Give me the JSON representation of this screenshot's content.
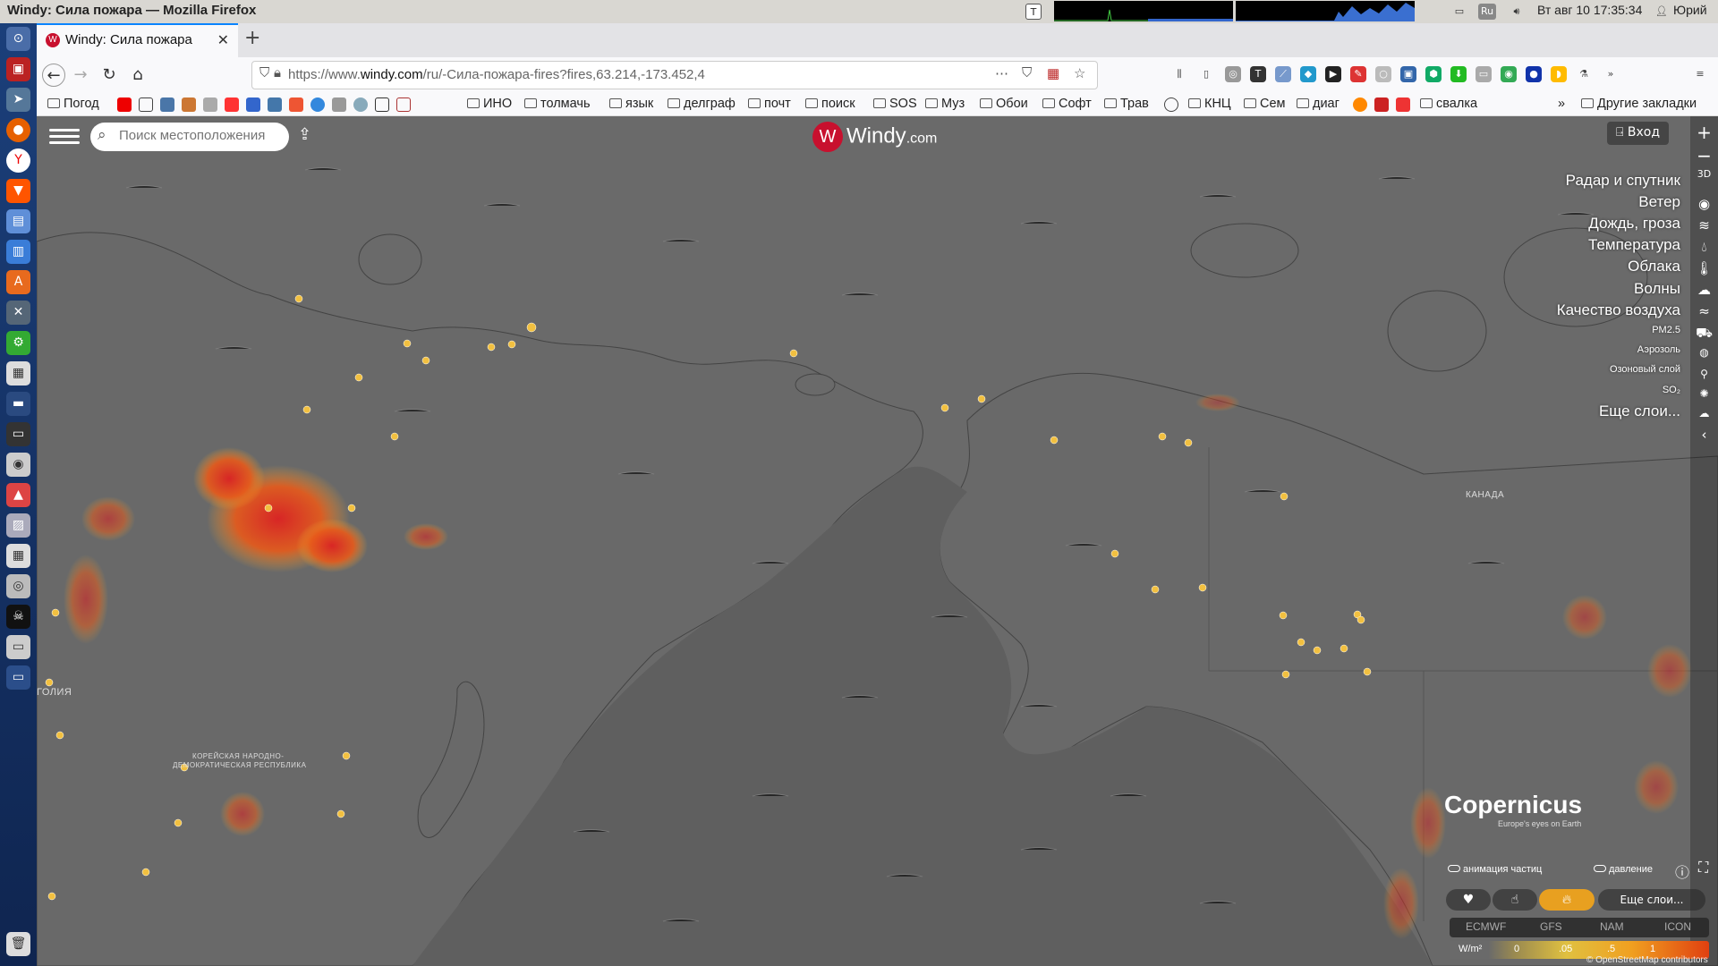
{
  "window": {
    "title": "Windy: Сила пожара — Mozilla Firefox"
  },
  "system": {
    "clock": "Вт авг 10 17:35:34",
    "user": "Юрий",
    "keyboard": "Ru"
  },
  "tabs": [
    {
      "title": "Windy: Сила пожара"
    }
  ],
  "url": {
    "prefix": "https://www.",
    "domain": "windy.com",
    "path": "/ru/-Сила-пожара-fires?fires,63.214,-173.452,4"
  },
  "bookmarks": [
    "Погод",
    "ИНО",
    "толмачь",
    "язык",
    "делграф",
    "почт",
    "поиск",
    "SOS",
    "Муз",
    "Обои",
    "Софт",
    "Трав",
    "КНЦ",
    "Сем",
    "диаг",
    "свалка",
    "Другие закладки"
  ],
  "map": {
    "search_placeholder": "Поиск местоположения",
    "logo_main": "Windy",
    "logo_suffix": ".com",
    "login_label": "Вход",
    "zoom_in": "+",
    "zoom_out": "−",
    "mode_3d": "3D",
    "layers": {
      "radar": "Радар и спутник",
      "wind": "Ветер",
      "rain": "Дождь, гроза",
      "temp": "Температура",
      "clouds": "Облака",
      "waves": "Волны",
      "air": "Качество воздуха",
      "pm25": "PM2.5",
      "aerosol": "Аэрозоль",
      "ozone": "Озоновый слой",
      "so2": "SO₂",
      "more": "Еще слои..."
    },
    "labels": {
      "canada": "КАНАДА",
      "mongolia": "ГОЛИЯ",
      "korea1": "КОРЕЙСКАЯ НАРОДНО-",
      "korea2": "ДЕМОКРАТИЧЕСКАЯ РЕСПУБЛИКА"
    },
    "copernicus": {
      "name": "opernicus",
      "tagline": "Europe's eyes on Earth"
    },
    "toggles": {
      "particles": "анимация частиц",
      "pressure": "давление"
    },
    "more_layers": "Еще слои...",
    "models": [
      "ECMWF",
      "GFS",
      "NAM",
      "ICON"
    ],
    "scale": {
      "unit": "W/m²",
      "ticks": [
        "0",
        ".05",
        ".5",
        "1"
      ]
    },
    "attribution": "© OpenStreetMap contributors"
  }
}
